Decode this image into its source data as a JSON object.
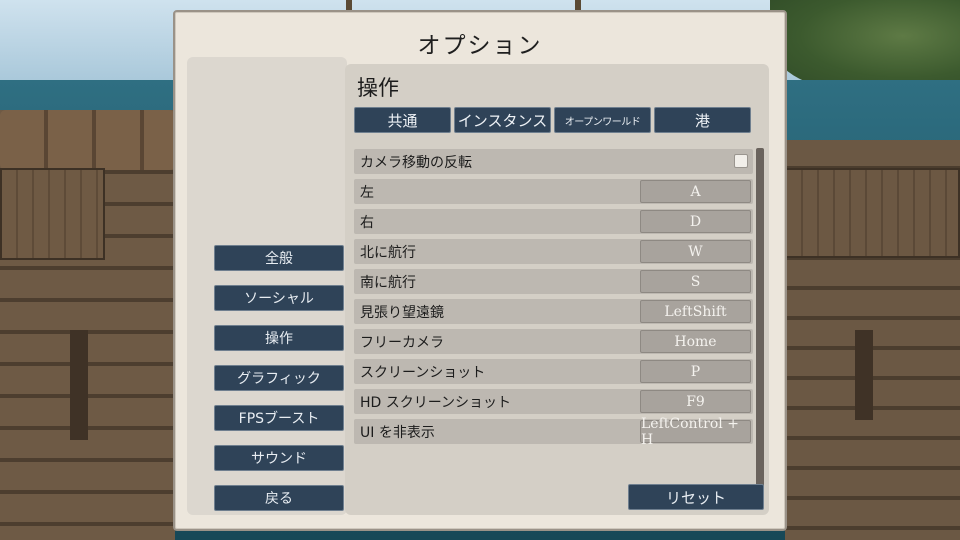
{
  "dialog": {
    "title": "オプション"
  },
  "nav": [
    {
      "label": "全般"
    },
    {
      "label": "ソーシャル"
    },
    {
      "label": "操作"
    },
    {
      "label": "グラフィック"
    },
    {
      "label": "FPSブースト"
    },
    {
      "label": "サウンド"
    },
    {
      "label": "戻る"
    }
  ],
  "section": {
    "title": "操作"
  },
  "tabs": [
    {
      "label": "共通"
    },
    {
      "label": "インスタンス"
    },
    {
      "label": "オープンワールド"
    },
    {
      "label": "港"
    }
  ],
  "settings": [
    {
      "label": "カメラ移動の反転",
      "checked": false
    },
    {
      "label": "左",
      "key": "A"
    },
    {
      "label": "右",
      "key": "D"
    },
    {
      "label": "北に航行",
      "key": "W"
    },
    {
      "label": "南に航行",
      "key": "S"
    },
    {
      "label": "見張り望遠鏡",
      "key": "LeftShift"
    },
    {
      "label": "フリーカメラ",
      "key": "Home"
    },
    {
      "label": "スクリーンショット",
      "key": "P"
    },
    {
      "label": "HD スクリーンショット",
      "key": "F9"
    },
    {
      "label": "UI を非表示",
      "key": "LeftControl + H"
    }
  ],
  "reset_label": "リセット",
  "colors": {
    "button": "#2f4358",
    "panel": "#ece6dc",
    "row": "#bdb8b1",
    "key": "#a8a39d"
  }
}
